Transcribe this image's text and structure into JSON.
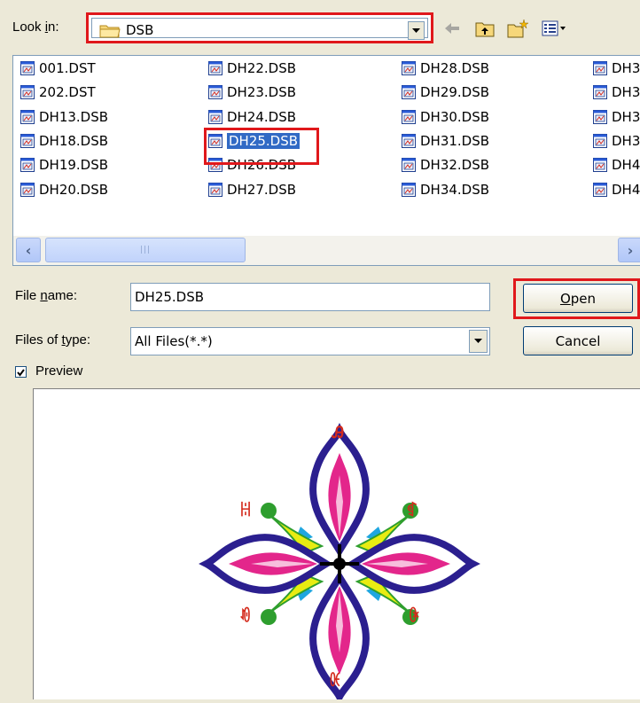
{
  "look_in": {
    "label_pre": "Look ",
    "label_key": "i",
    "label_post": "n:",
    "value": "DSB"
  },
  "files": [
    {
      "name": "001.DST",
      "type": "dst"
    },
    {
      "name": "202.DST",
      "type": "dst"
    },
    {
      "name": "DH13.DSB",
      "type": "dsb"
    },
    {
      "name": "DH18.DSB",
      "type": "dsb"
    },
    {
      "name": "DH19.DSB",
      "type": "dsb"
    },
    {
      "name": "DH20.DSB",
      "type": "dsb"
    },
    {
      "name": "DH22.DSB",
      "type": "dsb"
    },
    {
      "name": "DH23.DSB",
      "type": "dsb"
    },
    {
      "name": "DH24.DSB",
      "type": "dsb"
    },
    {
      "name": "DH25.DSB",
      "type": "dsb",
      "selected": true
    },
    {
      "name": "DH26.DSB",
      "type": "dsb"
    },
    {
      "name": "DH27.DSB",
      "type": "dsb"
    },
    {
      "name": "DH28.DSB",
      "type": "dsb"
    },
    {
      "name": "DH29.DSB",
      "type": "dsb"
    },
    {
      "name": "DH30.DSB",
      "type": "dsb"
    },
    {
      "name": "DH31.DSB",
      "type": "dsb"
    },
    {
      "name": "DH32.DSB",
      "type": "dsb"
    },
    {
      "name": "DH34.DSB",
      "type": "dsb"
    },
    {
      "name": "DH3",
      "type": "dsb"
    },
    {
      "name": "DH3",
      "type": "dsb"
    },
    {
      "name": "DH3",
      "type": "dsb"
    },
    {
      "name": "DH3",
      "type": "dsb"
    },
    {
      "name": "DH4",
      "type": "dsb"
    },
    {
      "name": "DH4",
      "type": "dsb"
    }
  ],
  "file_name": {
    "label_pre": "File ",
    "label_key": "n",
    "label_post": "ame:",
    "value": "DH25.DSB"
  },
  "file_type": {
    "label_pre": "Files of ",
    "label_key": "t",
    "label_post": "ype:",
    "value": "All Files(*.*)"
  },
  "buttons": {
    "open_key": "O",
    "open_rest": "pen",
    "cancel": "Cancel"
  },
  "preview": {
    "label": "Preview",
    "checked": true
  },
  "preview_texts": {
    "top": "Ꭿ",
    "left_upper": "ꀍ",
    "right_upper": "ꁍ",
    "left_lower": "ꀑ",
    "right_lower": "ꀖ",
    "bottom": "ꀚ"
  },
  "colors": {
    "highlight": "#e0181b",
    "selection": "#316ac5",
    "navy": "#2b1f8f",
    "pink": "#e3268b",
    "cyan": "#1fa6e0",
    "yellow": "#e8ec12",
    "green": "#2e9e2e",
    "red": "#d42a1c"
  },
  "scroll": {
    "left_arrow": "‹",
    "right_arrow": "›",
    "thumb_grip": "|||"
  }
}
